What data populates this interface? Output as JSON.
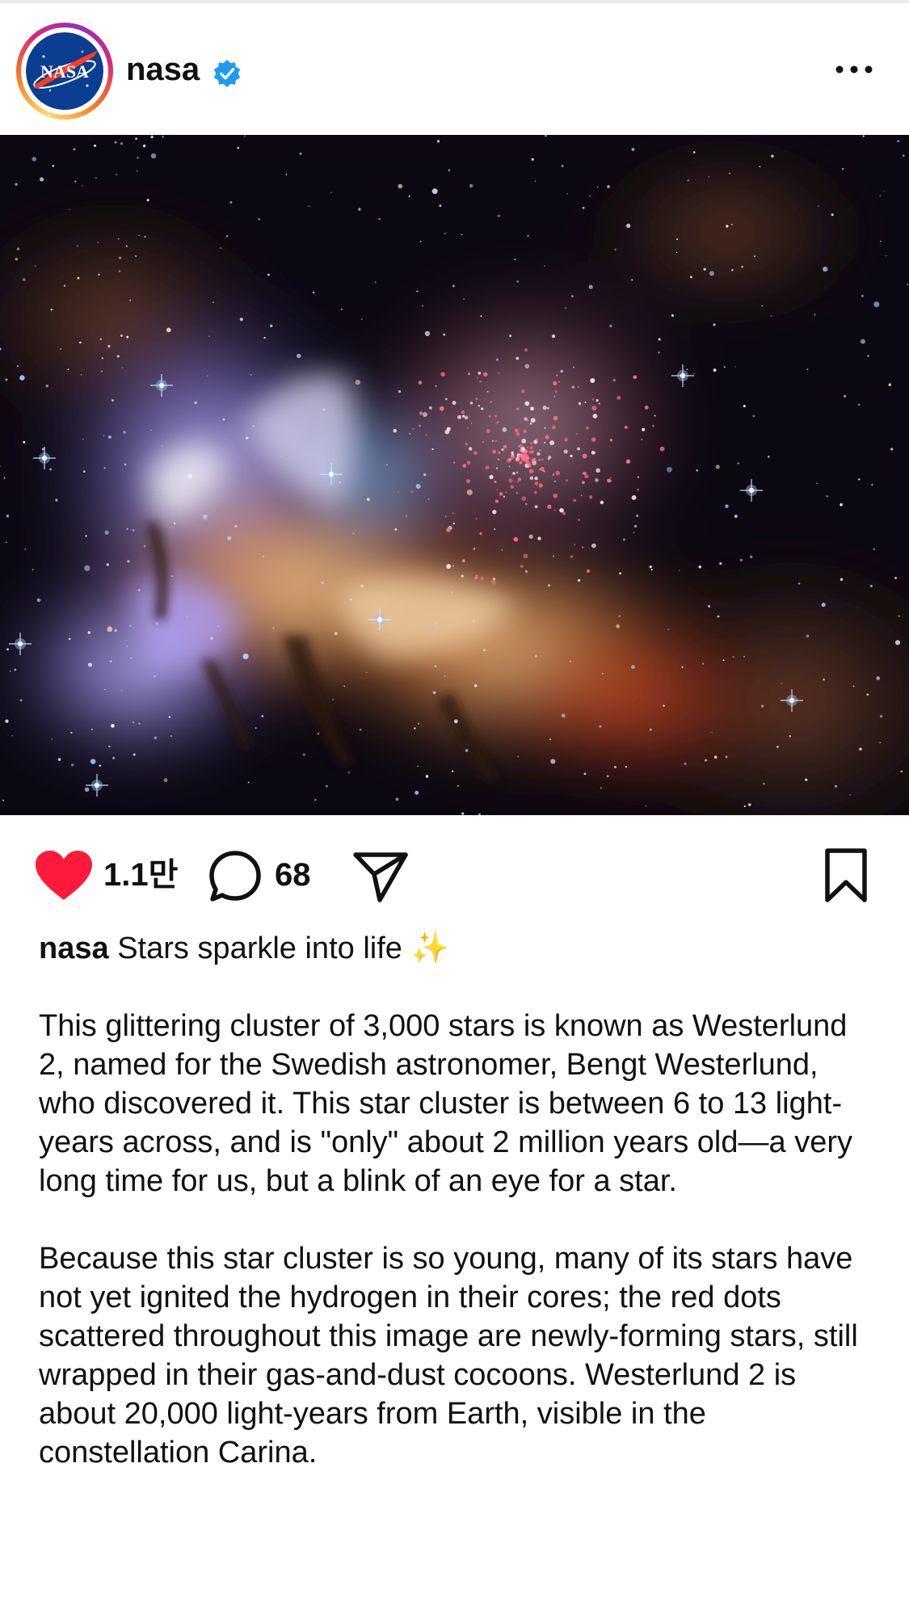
{
  "header": {
    "username": "nasa",
    "avatar_icon": "nasa-logo",
    "avatar_logo_text": "NASA",
    "verified_icon": "verified-badge-icon",
    "more_icon": "more-options-icon",
    "colors": {
      "verified": "#1d9bf0"
    }
  },
  "post": {
    "image_icon": "galaxy-photo",
    "likes": "1.1만",
    "comments": "68"
  },
  "actions": {
    "like_icon": "heart-icon",
    "comment_icon": "comment-icon",
    "share_icon": "send-icon",
    "save_icon": "bookmark-icon",
    "colors": {
      "heart": "#ff1a3c"
    }
  },
  "caption": {
    "author": "nasa",
    "headline": "Stars sparkle into life",
    "emoji": "✨",
    "paragraph1": "This glittering cluster of 3,000 stars is known as Westerlund 2, named for the Swedish astronomer, Bengt Westerlund, who discovered it. This star cluster is between 6 to 13 light-years across, and is \"only\" about 2 million years old—a very long time for us, but a blink of an eye for a star.",
    "paragraph2": "Because this star cluster is so young, many of its stars have not yet ignited the hydrogen in their cores; the red dots scattered throughout this image are newly-forming stars, still wrapped in their gas-and-dust cocoons. Westerlund 2 is about 20,000 light-years from Earth, visible in the constellation Carina."
  }
}
